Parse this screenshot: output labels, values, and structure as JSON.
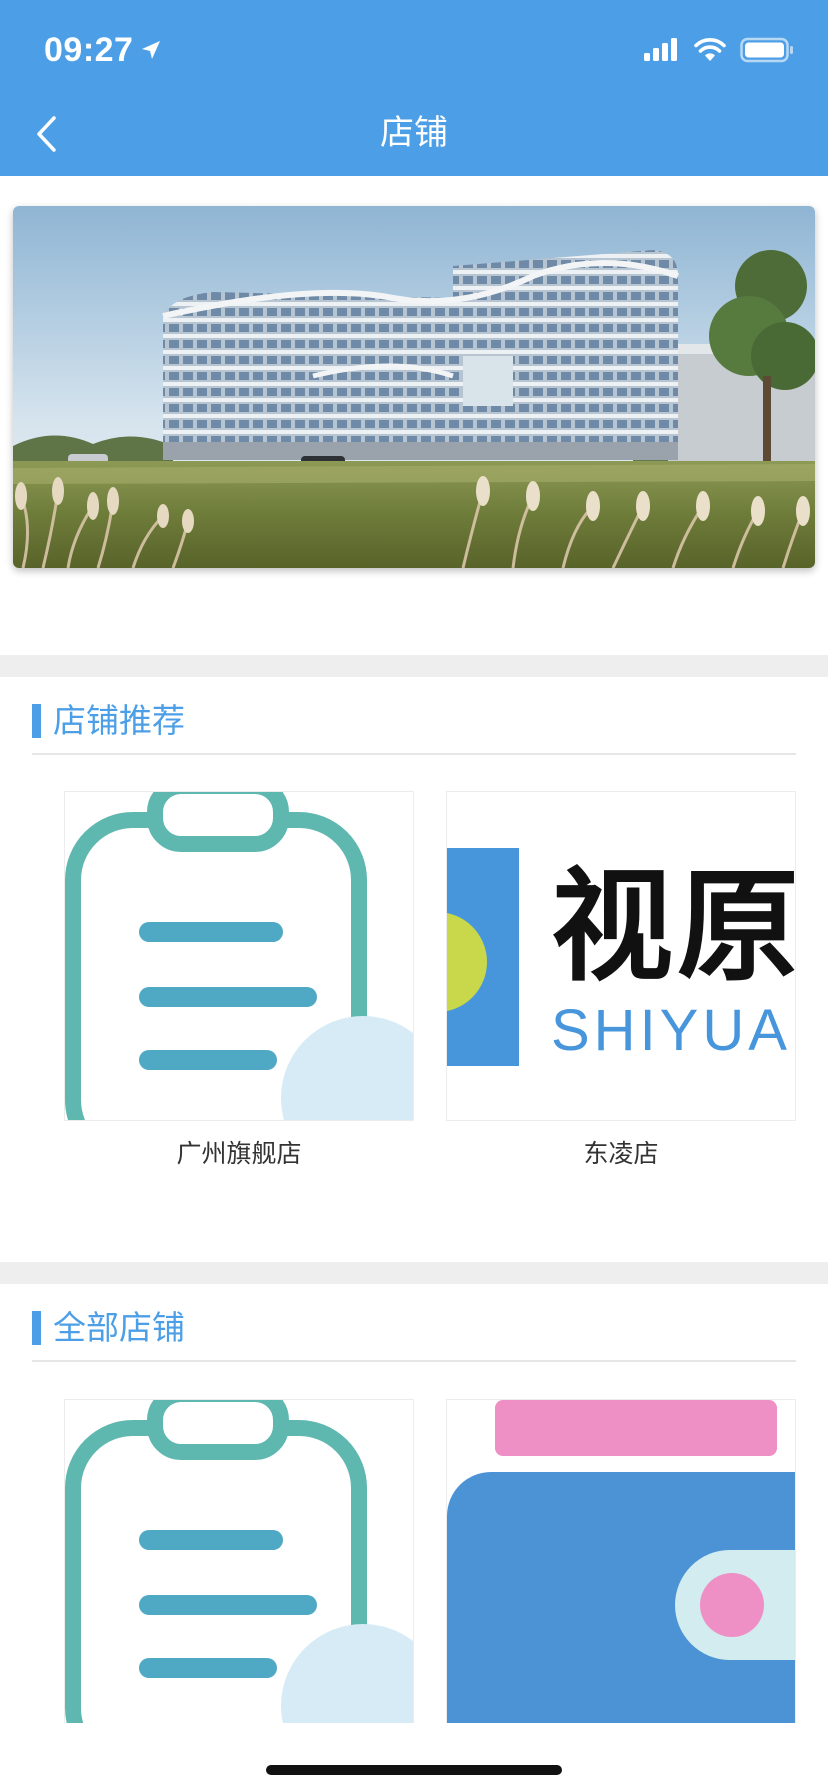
{
  "status_bar": {
    "time": "09:27",
    "icons": [
      "location-arrow-icon",
      "cellular-signal-icon",
      "wifi-icon",
      "battery-icon"
    ]
  },
  "nav": {
    "back_icon": "chevron-left-icon",
    "title": "店铺"
  },
  "banner": {
    "image": "office-building-photo"
  },
  "sections": {
    "recommended": {
      "title": "店铺推荐",
      "stores": [
        {
          "name": "广州旗舰店",
          "image": "clipboard-icon"
        },
        {
          "name": "东凌店",
          "image": "shiyuan-logo",
          "logo_text_cn": "视原",
          "logo_text_en": "SHIYUAN"
        }
      ]
    },
    "all": {
      "title": "全部店铺",
      "stores": [
        {
          "name": "",
          "image": "clipboard-icon"
        },
        {
          "name": "",
          "image": "wallet-icon"
        }
      ]
    }
  },
  "colors": {
    "primary": "#4c9fe6",
    "separator": "#eeeeee",
    "teal": "#5fb8b0",
    "pink": "#ee8fc6",
    "lime": "#c9d84a"
  }
}
